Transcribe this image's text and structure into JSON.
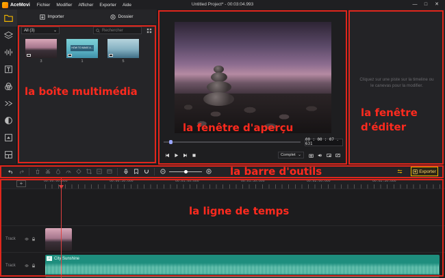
{
  "app": {
    "name": "AceMovi",
    "menu": [
      "Fichier",
      "Modifier",
      "Afficher",
      "Exporter",
      "Aide"
    ],
    "title": "Untitled Project* - 00:03:04.993",
    "window_controls": [
      "—",
      "□",
      "✕"
    ]
  },
  "sidebar": {
    "icons": [
      "folder-icon",
      "layers-icon",
      "audio-wave-icon",
      "text-icon",
      "effects-icon",
      "transition-icon",
      "filter-icon",
      "overlay-icon",
      "layout-icon"
    ]
  },
  "media": {
    "import_label": "Importer",
    "folder_label": "Dossier",
    "filter_value": "All (3)",
    "search_placeholder": "Rechercher",
    "items": [
      {
        "caption": "3",
        "text": ""
      },
      {
        "caption": "1",
        "text": "HOW TO MAKE A..."
      },
      {
        "caption": "5",
        "text": ""
      }
    ]
  },
  "preview": {
    "timecode": "00 : 00 : 07 . 631",
    "zoom": "Complet",
    "progress": 0.04
  },
  "editor": {
    "hint": "Cliquez sur une piste sur la timeline ou le canevas pour la modifier."
  },
  "toolbar": {
    "export_label": "Exporter",
    "zoom_level": 0.5
  },
  "timeline": {
    "add_label": "+",
    "ruler": [
      "00:00:00.000",
      "00:00:30.000",
      "00:01:00.000",
      "00:01:30.000",
      "00:02:00.000",
      "00:02:30.000"
    ],
    "tracks": [
      {
        "label": "Track",
        "type": "video"
      },
      {
        "label": "Track",
        "type": "audio",
        "clip_name": "City Sunshine",
        "clip_badge": "♫"
      }
    ]
  },
  "annotations": {
    "media": "la boîte multimédia",
    "preview": "la fenêtre d'aperçu",
    "editor_line1": "la fenêtre",
    "editor_line2": "d'éditer",
    "toolbar": "la barre d'outils",
    "timeline": "la ligne de temps"
  },
  "colors": {
    "accent": "#f2b600",
    "annotation": "#e1261c",
    "audio_clip": "#1e8e7e",
    "playhead": "#e04040"
  }
}
